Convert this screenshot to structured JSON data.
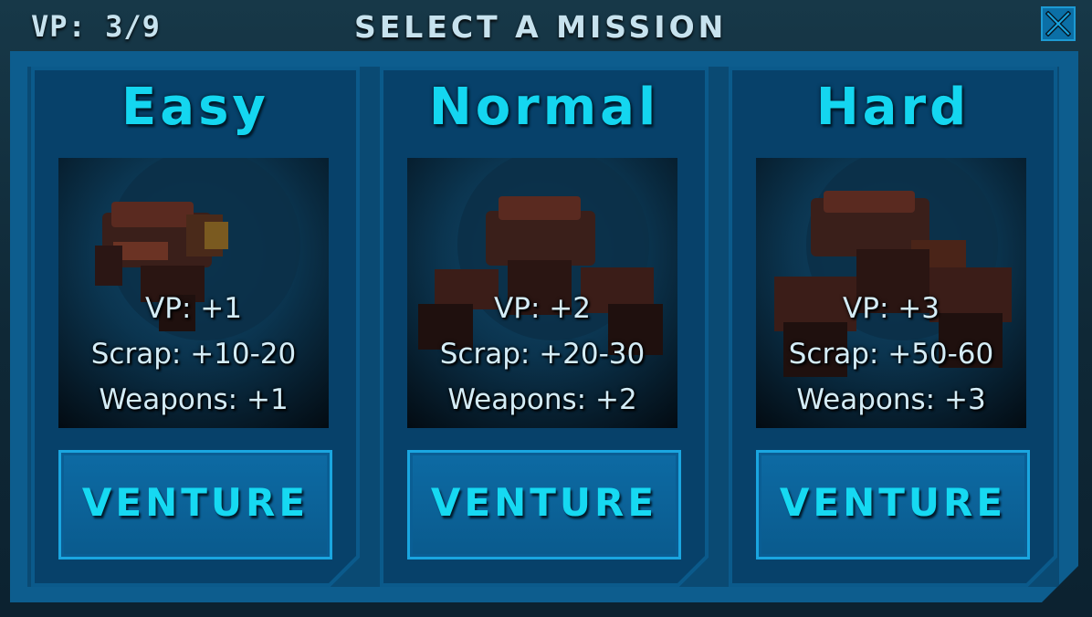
{
  "header": {
    "vp_status": "VP: 3/9",
    "title": "SELECT A MISSION",
    "close_icon": "close-icon"
  },
  "colors": {
    "accent": "#14d6f0",
    "panel": "#07416a",
    "frame": "#0d5d8e",
    "button_border": "#1aa6e0"
  },
  "missions": [
    {
      "difficulty": "Easy",
      "vp": "VP: +1",
      "scrap": "Scrap: +10-20",
      "weapons": "Weapons: +1",
      "button_label": "VENTURE"
    },
    {
      "difficulty": "Normal",
      "vp": "VP: +2",
      "scrap": "Scrap: +20-30",
      "weapons": "Weapons: +2",
      "button_label": "VENTURE"
    },
    {
      "difficulty": "Hard",
      "vp": "VP: +3",
      "scrap": "Scrap: +50-60",
      "weapons": "Weapons: +3",
      "button_label": "VENTURE"
    }
  ]
}
